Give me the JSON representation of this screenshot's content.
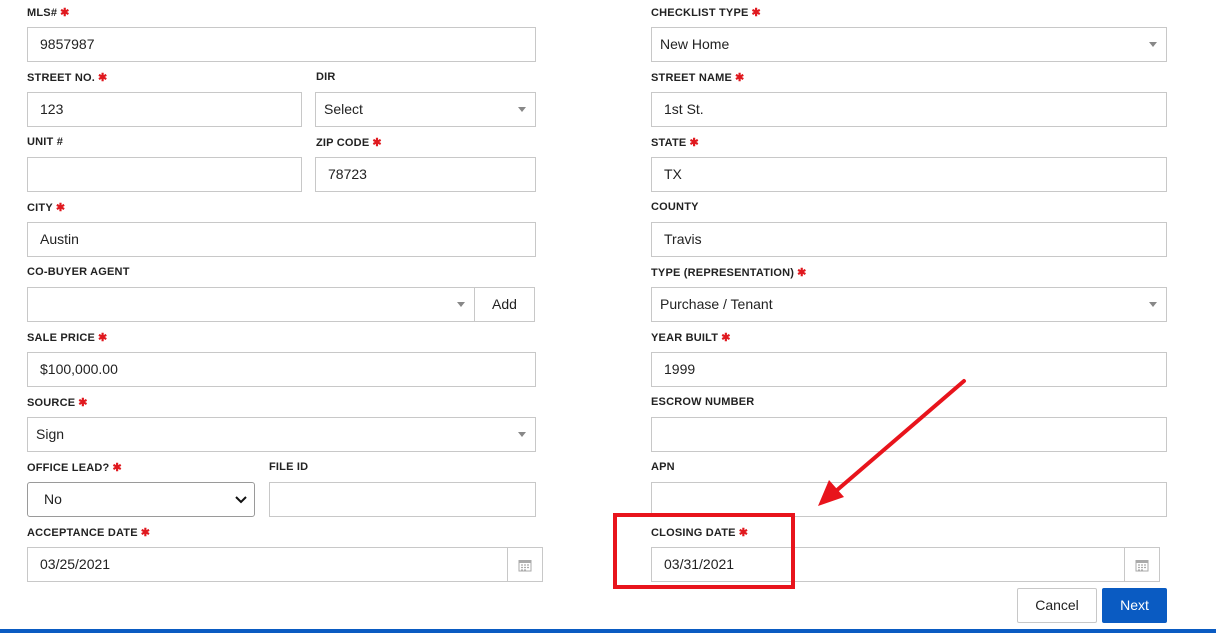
{
  "form": {
    "mls": {
      "label": "MLS#",
      "value": "9857987"
    },
    "checklist_type": {
      "label": "CHECKLIST TYPE",
      "value": "New Home"
    },
    "street_no": {
      "label": "STREET NO.",
      "value": "123"
    },
    "dir": {
      "label": "DIR",
      "value": "Select"
    },
    "street_name": {
      "label": "STREET NAME",
      "value": "1st St."
    },
    "unit": {
      "label": "UNIT #",
      "value": ""
    },
    "zip": {
      "label": "ZIP CODE",
      "value": "78723"
    },
    "state": {
      "label": "STATE",
      "value": "TX"
    },
    "city": {
      "label": "CITY",
      "value": "Austin"
    },
    "county": {
      "label": "COUNTY",
      "value": "Travis"
    },
    "co_buyer_agent": {
      "label": "CO-BUYER AGENT",
      "value": "",
      "add_label": "Add"
    },
    "type_representation": {
      "label": "TYPE (REPRESENTATION)",
      "value": "Purchase / Tenant"
    },
    "sale_price": {
      "label": "SALE PRICE",
      "value": "$100,000.00"
    },
    "year_built": {
      "label": "YEAR BUILT",
      "value": "1999"
    },
    "source": {
      "label": "SOURCE",
      "value": "Sign"
    },
    "escrow_number": {
      "label": "ESCROW NUMBER",
      "value": ""
    },
    "office_lead": {
      "label": "OFFICE LEAD?",
      "value": "No"
    },
    "file_id": {
      "label": "FILE ID",
      "value": ""
    },
    "apn": {
      "label": "APN",
      "value": ""
    },
    "acceptance_date": {
      "label": "ACCEPTANCE DATE",
      "value": "03/25/2021"
    },
    "closing_date": {
      "label": "CLOSING DATE",
      "value": "03/31/2021"
    },
    "required_mark": "✱"
  },
  "actions": {
    "cancel_label": "Cancel",
    "next_label": "Next"
  },
  "colors": {
    "accent": "#0a5bc2",
    "required": "#e0191f",
    "annotation": "#e8141c"
  },
  "icons": {
    "calendar": "calendar-icon",
    "dropdown": "chevron-down-icon"
  }
}
